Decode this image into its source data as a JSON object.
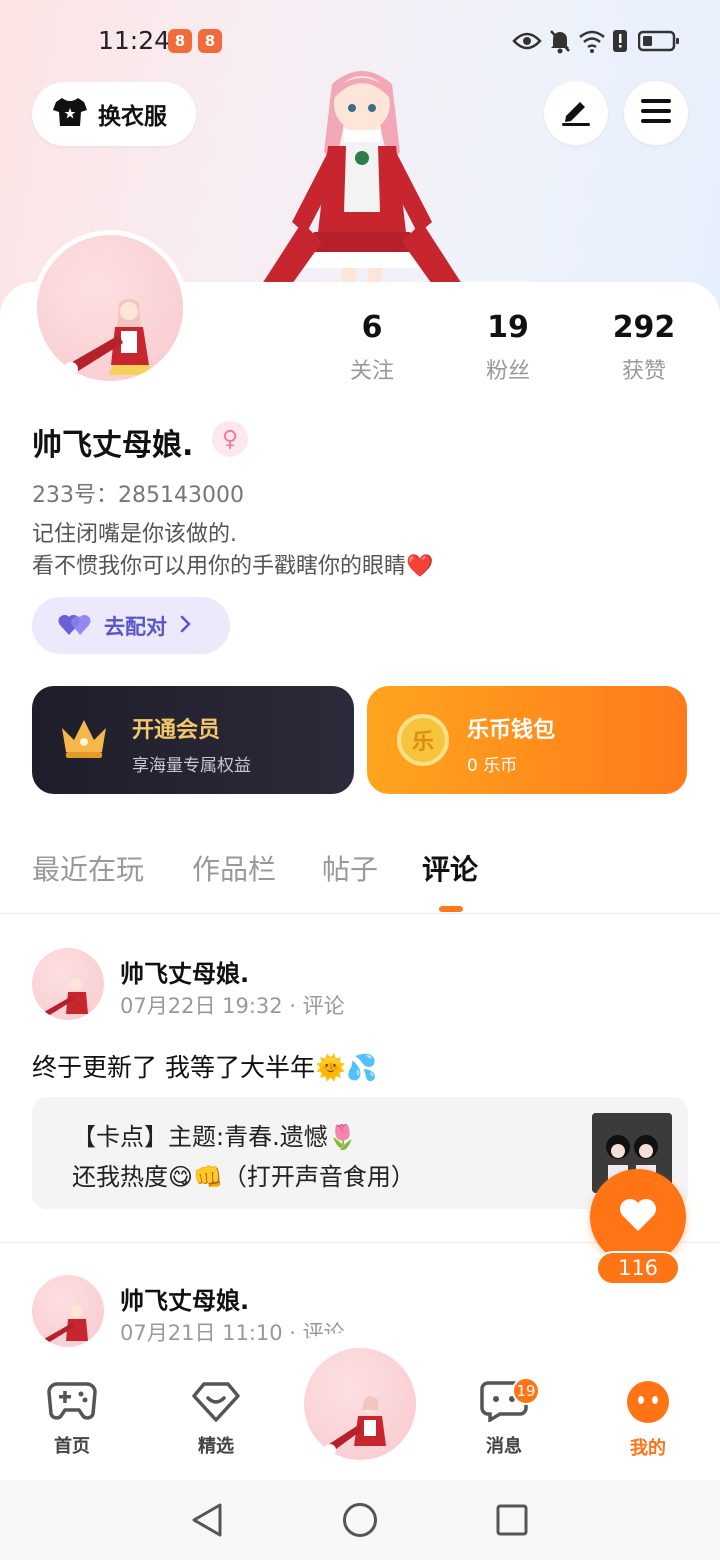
{
  "status_bar": {
    "time": "11:24",
    "app_badges": [
      "8",
      "8"
    ]
  },
  "header": {
    "outfit_label": "换衣服"
  },
  "profile": {
    "stats": [
      {
        "value": "6",
        "label": "关注"
      },
      {
        "value": "19",
        "label": "粉丝"
      },
      {
        "value": "292",
        "label": "获赞"
      }
    ],
    "username": "帅飞丈母娘.",
    "gender_symbol": "♀",
    "uid": "233号：285143000",
    "bio_line1": "记住闭嘴是你该做的.",
    "bio_line2": "看不惯我你可以用你的手戳瞎你的眼睛❤️",
    "match_label": "去配对"
  },
  "promos": {
    "vip": {
      "title": "开通会员",
      "subtitle": "享海量专属权益"
    },
    "wallet": {
      "title": "乐币钱包",
      "subtitle": "0 乐币",
      "coin_char": "乐"
    }
  },
  "tabs": [
    {
      "label": "最近在玩"
    },
    {
      "label": "作品栏"
    },
    {
      "label": "帖子"
    },
    {
      "label": "评论",
      "active": true
    }
  ],
  "posts": [
    {
      "author": "帅飞丈母娘.",
      "meta": "07月22日 19:32 · 评论",
      "text": "终于更新了 我等了大半年🌞💦",
      "quote_line1": "【卡点】主题:青春.遗憾🌷",
      "quote_line2": "还我热度😋👊（打开声音食用）"
    },
    {
      "author": "帅飞丈母娘.",
      "meta": "07月21日 11:10 · 评论"
    }
  ],
  "like_fab": {
    "count": "116"
  },
  "bottom_nav": {
    "items": [
      {
        "label": "首页"
      },
      {
        "label": "精选"
      },
      {
        "label": "消息",
        "badge": "19"
      },
      {
        "label": "我的",
        "active": true
      }
    ]
  },
  "colors": {
    "accent": "#ff7414",
    "match": "#5a56c9",
    "vip_gold": "#f5c76b"
  }
}
